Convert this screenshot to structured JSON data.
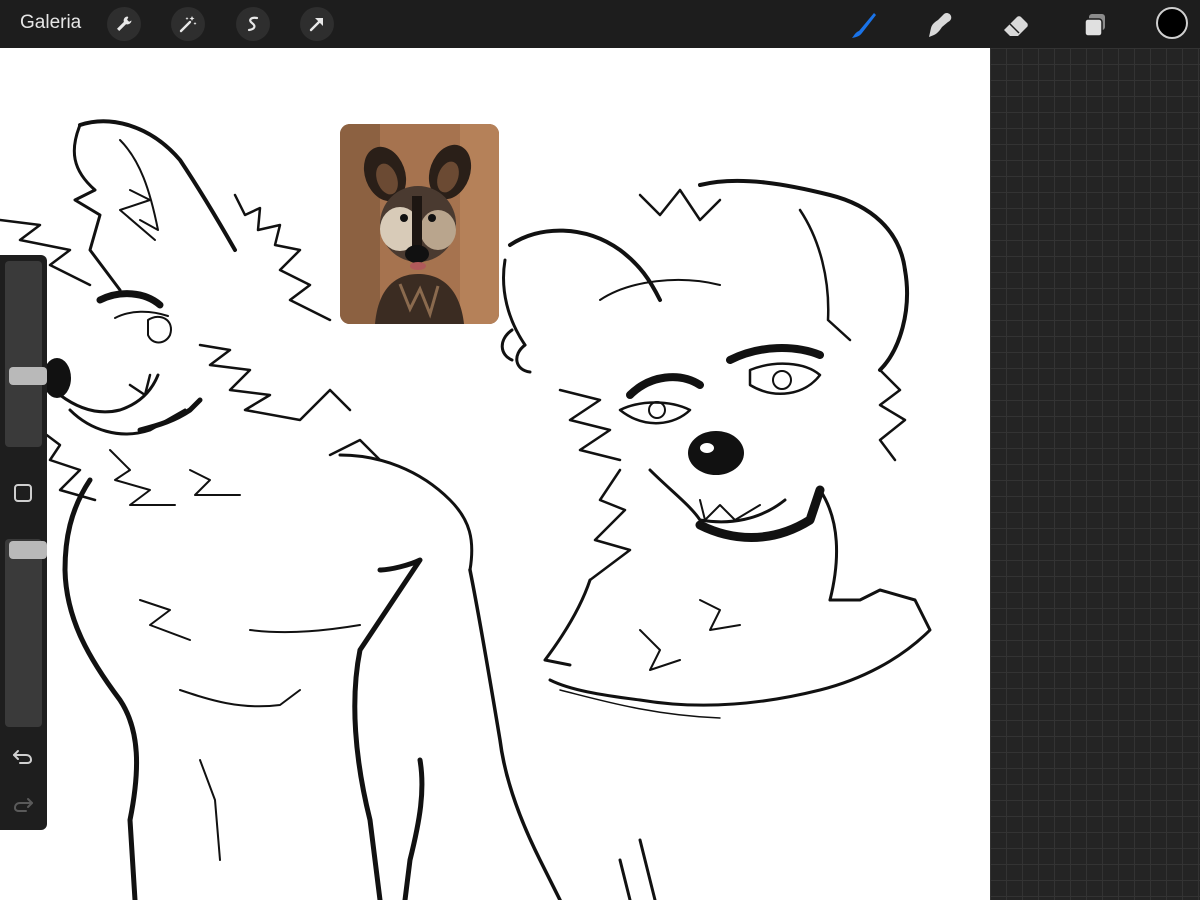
{
  "app": {
    "gallery_label": "Galeria"
  },
  "toolbar": {
    "left_tools": [
      "actions-wrench-icon",
      "adjustments-magic-wand-icon",
      "selection-icon",
      "transform-arrow-icon"
    ],
    "right_tools": [
      "brush-icon",
      "smudge-icon",
      "eraser-icon",
      "layers-icon"
    ],
    "active_tool": "brush",
    "active_tool_color": "#1a73e8",
    "current_color": "#000000"
  },
  "sidebar": {
    "brush_size_level": 0.62,
    "opacity_level": 0.98,
    "icons": [
      "modify-square-icon",
      "undo-icon",
      "redo-icon"
    ]
  },
  "canvas": {
    "background": "#ffffff",
    "reference_image": "african-wild-dog-photo"
  }
}
